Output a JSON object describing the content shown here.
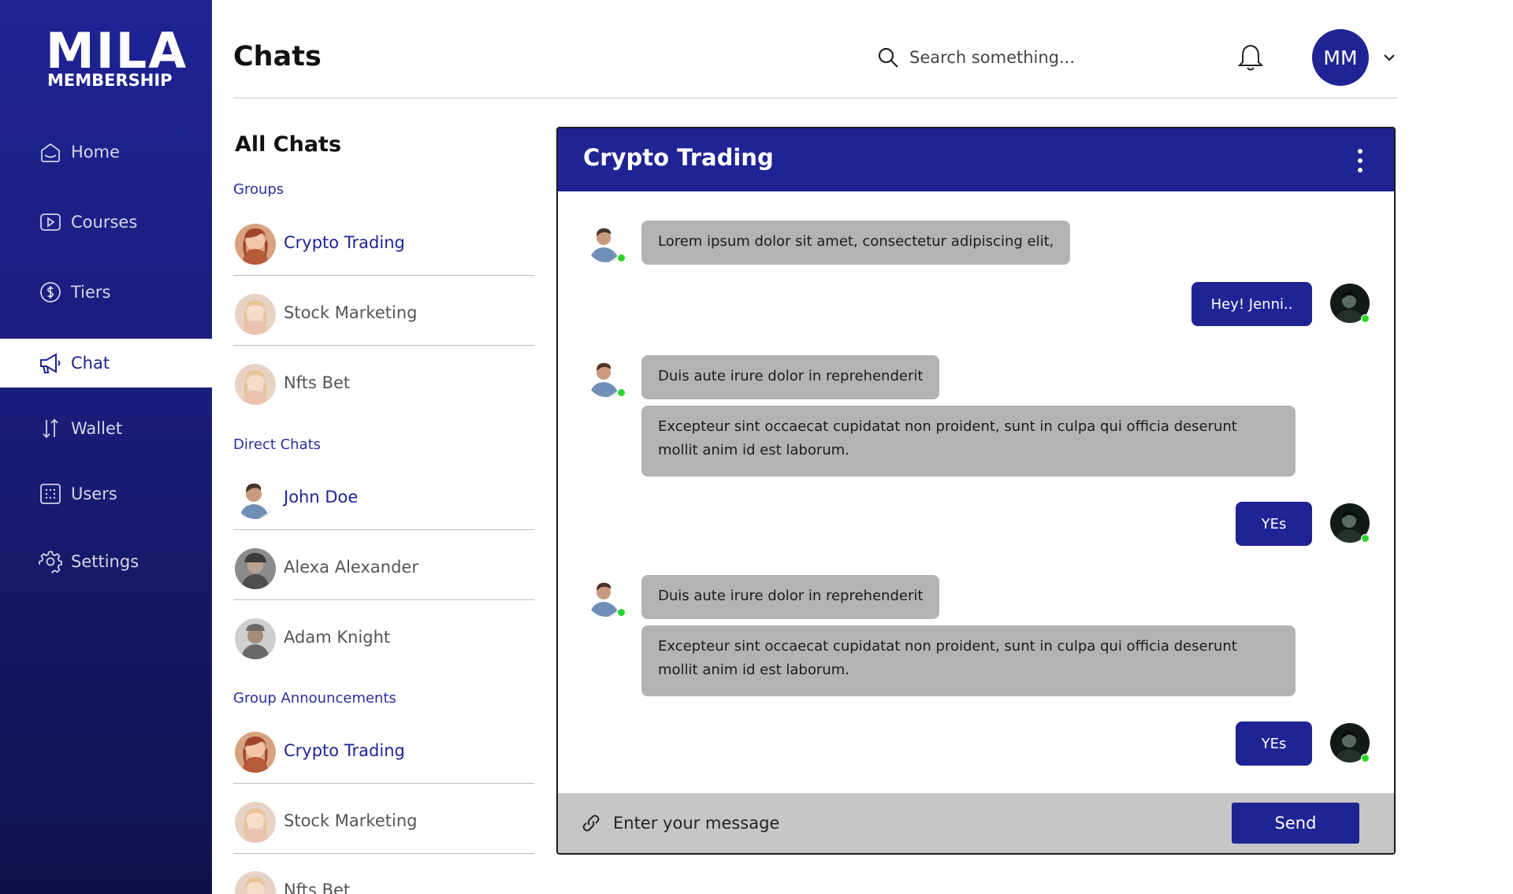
{
  "brand": {
    "main": "MILA",
    "sub": "MEMBERSHIP"
  },
  "nav": [
    {
      "label": "Home",
      "icon": "home-icon"
    },
    {
      "label": "Courses",
      "icon": "play-icon"
    },
    {
      "label": "Tiers",
      "icon": "dollar-icon"
    },
    {
      "label": "Chat",
      "icon": "megaphone-icon",
      "active": true
    },
    {
      "label": "Wallet",
      "icon": "transfer-icon"
    },
    {
      "label": "Users",
      "icon": "grid-icon"
    },
    {
      "label": "Settings",
      "icon": "gear-icon"
    }
  ],
  "header": {
    "title": "Chats",
    "search_placeholder": "Search something...",
    "user_initials": "MM"
  },
  "list": {
    "title": "All Chats",
    "sections": {
      "groups": "Groups",
      "direct": "Direct Chats",
      "announcements": "Group Announcements"
    },
    "groups": [
      "Crypto Trading",
      "Stock Marketing",
      "Nfts Bet"
    ],
    "direct": [
      "John Doe",
      "Alexa Alexander",
      "Adam Knight"
    ],
    "announcements": [
      "Crypto Trading",
      "Stock Marketing",
      "Nfts Bet"
    ]
  },
  "chat": {
    "title": "Crypto Trading",
    "messages": [
      {
        "dir": "in",
        "text": "Lorem ipsum dolor sit amet, consectetur adipiscing elit,"
      },
      {
        "dir": "out",
        "text": "Hey! Jenni.."
      },
      {
        "dir": "in",
        "text": "Duis aute irure dolor in reprehenderit"
      },
      {
        "dir": "in",
        "text": "Excepteur sint occaecat cupidatat non proident, sunt in culpa qui officia deserunt mollit anim id est laborum."
      },
      {
        "dir": "out",
        "text": "YEs"
      },
      {
        "dir": "in",
        "text": "Duis aute irure dolor in reprehenderit"
      },
      {
        "dir": "in",
        "text": "Excepteur sint occaecat cupidatat non proident, sunt in culpa qui officia deserunt mollit anim id est laborum."
      },
      {
        "dir": "out",
        "text": "YEs"
      }
    ],
    "composer_placeholder": "Enter your message",
    "send_label": "Send"
  },
  "colors": {
    "primary": "#1f2394",
    "bubble_in": "#b3b3b3",
    "online": "#2bd62b"
  }
}
